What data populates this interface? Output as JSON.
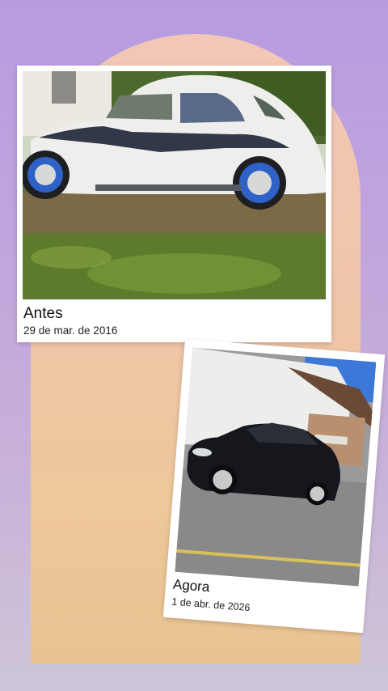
{
  "cards": [
    {
      "title": "Antes",
      "date": "29 de mar. de 2016",
      "photo": "white-beetle-car-photo"
    },
    {
      "title": "Agora",
      "date": "1 de abr. de 2026",
      "photo": "black-hatchback-car-photo"
    }
  ],
  "colors": {
    "background_top": "#b79be0",
    "arch": "#efc5a8",
    "card": "#ffffff"
  }
}
